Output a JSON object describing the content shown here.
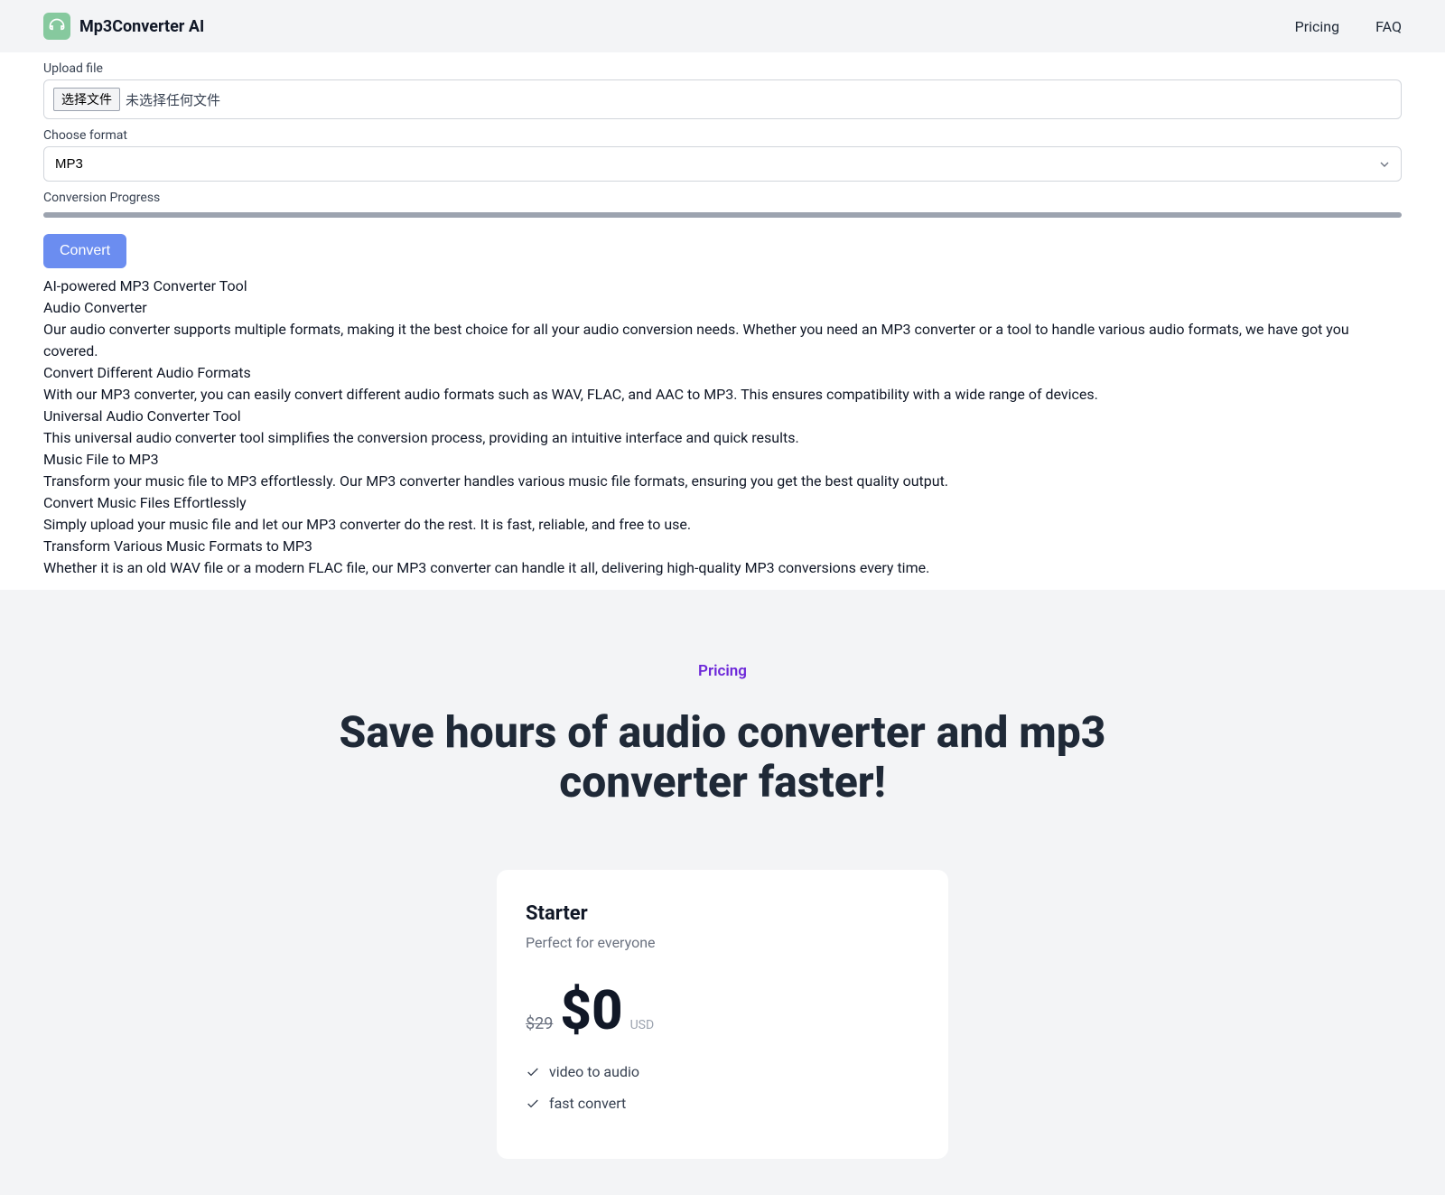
{
  "header": {
    "brand": "Mp3Converter AI",
    "nav": {
      "pricing": "Pricing",
      "faq": "FAQ"
    }
  },
  "upload": {
    "label": "Upload file",
    "choose_button": "选择文件",
    "status": "未选择任何文件"
  },
  "format": {
    "label": "Choose format",
    "selected": "MP3"
  },
  "progress": {
    "label": "Conversion Progress"
  },
  "convert": {
    "button": "Convert"
  },
  "content": {
    "h1": "AI-powered MP3 Converter Tool",
    "s1_title": "Audio Converter",
    "s1_body": "Our audio converter supports multiple formats, making it the best choice for all your audio conversion needs. Whether you need an MP3 converter or a tool to handle various audio formats, we have got you covered.",
    "s2_title": "Convert Different Audio Formats",
    "s2_body": "With our MP3 converter, you can easily convert different audio formats such as WAV, FLAC, and AAC to MP3. This ensures compatibility with a wide range of devices.",
    "s3_title": "Universal Audio Converter Tool",
    "s3_body": "This universal audio converter tool simplifies the conversion process, providing an intuitive interface and quick results.",
    "s4_title": "Music File to MP3",
    "s4_body": "Transform your music file to MP3 effortlessly. Our MP3 converter handles various music file formats, ensuring you get the best quality output.",
    "s5_title": "Convert Music Files Effortlessly",
    "s5_body": "Simply upload your music file and let our MP3 converter do the rest. It is fast, reliable, and free to use.",
    "s6_title": "Transform Various Music Formats to MP3",
    "s6_body": "Whether it is an old WAV file or a modern FLAC file, our MP3 converter can handle it all, delivering high-quality MP3 conversions every time."
  },
  "pricing": {
    "label": "Pricing",
    "title": "Save hours of audio converter and mp3 converter faster!",
    "plan": {
      "name": "Starter",
      "desc": "Perfect for everyone",
      "old_price": "$29",
      "price": "$0",
      "currency": "USD",
      "feature1": "video to audio",
      "feature2": "fast convert"
    }
  }
}
